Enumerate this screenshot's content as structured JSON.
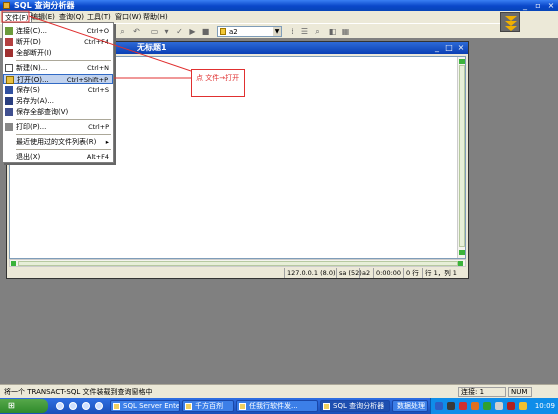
{
  "window": {
    "title": "SQL 查询分析器"
  },
  "menubar": [
    "文件(F)",
    "编辑(E)",
    "查询(Q)",
    "工具(T)",
    "窗口(W)",
    "帮助(H)"
  ],
  "toolbar": {
    "database": "a2"
  },
  "query_window": {
    "title": "无标题1"
  },
  "file_menu": {
    "items": [
      {
        "icon": "connect-icon",
        "label": "连接(C)...",
        "shortcut": "Ctrl+O"
      },
      {
        "icon": "disconnect-icon",
        "label": "断开(D)",
        "shortcut": "Ctrl+F4"
      },
      {
        "icon": "disconnect-all-icon",
        "label": "全部断开(I)",
        "shortcut": ""
      },
      {
        "icon": "new-icon",
        "label": "新建(N)...",
        "shortcut": "Ctrl+N"
      },
      {
        "icon": "open-folder-icon",
        "label": "打开(O)...",
        "shortcut": "Ctrl+Shift+P"
      },
      {
        "icon": "save-icon",
        "label": "保存(S)",
        "shortcut": "Ctrl+S"
      },
      {
        "icon": "save-as-icon",
        "label": "另存为(A)...",
        "shortcut": ""
      },
      {
        "icon": "save-all-icon",
        "label": "保存全部查询(V)",
        "shortcut": ""
      },
      {
        "icon": "print-icon",
        "label": "打印(P)...",
        "shortcut": "Ctrl+P"
      },
      {
        "icon": "",
        "label": "最近使用过的文件列表(R)",
        "shortcut": "▸"
      },
      {
        "icon": "",
        "label": "退出(X)",
        "shortcut": "Alt+F4"
      }
    ]
  },
  "annotation": {
    "text": "点 文件→打开"
  },
  "query_status": [
    "127.0.0.1 (8.0)",
    "sa (52)",
    "a2",
    "0:00:00",
    "0 行",
    "行 1，列 1"
  ],
  "app_status": {
    "text": "将一个 TRANSACT-SQL 文件装载到查询窗格中",
    "connections": "连接: 1",
    "num": "NUM"
  },
  "taskbar": {
    "tasks": [
      "SQL Server Ente...",
      "千方百剂",
      "任我行软件发...",
      "SQL 查询分析器"
    ],
    "tray_label": "数据处理",
    "clock": "10:09"
  },
  "colors": {
    "title_blue": "#0a47c9",
    "annotation_red": "#e03030",
    "menu_highlight": "#c1d2ee"
  }
}
